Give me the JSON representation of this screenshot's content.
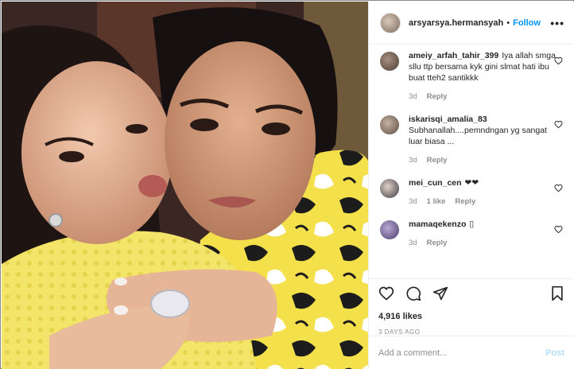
{
  "post": {
    "photo_alt": "",
    "header": {
      "username": "arsyarsya.hermansyah",
      "separator": "•",
      "follow_label": "Follow",
      "more_icon": "more-horizontal-icon"
    },
    "comments": [
      {
        "username": "ameiy_arfah_tahir_399",
        "text": "Iya allah smga sllu ttp bersama kyk gini slmat hati ibu buat tteh2 santikkk",
        "age": "3d",
        "likes": "",
        "reply_label": "Reply",
        "avatar_color": "#6e6055"
      },
      {
        "username": "iskarisqi_amalia_83",
        "text": "Subhanallah....pemndngan yg sangat luar biasa ...",
        "age": "3d",
        "likes": "",
        "reply_label": "Reply",
        "avatar_color": "#7d6e62"
      },
      {
        "username": "mei_cun_cen",
        "text": "❤❤",
        "age": "3d",
        "likes": "1 like",
        "reply_label": "Reply",
        "avatar_color": "#4f5d73"
      },
      {
        "username": "mamaqekenzo",
        "text": "▯",
        "age": "3d",
        "likes": "",
        "reply_label": "Reply",
        "avatar_color": "#8a7aa8"
      }
    ],
    "like_count": "4,916 likes",
    "time_ago": "3 DAYS AGO",
    "add_comment_placeholder": "Add a comment...",
    "post_label": "Post"
  }
}
